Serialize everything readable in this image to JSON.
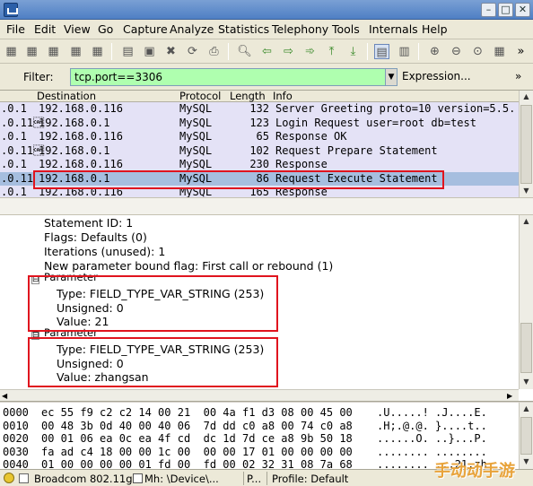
{
  "window": {
    "minimize": "–",
    "maximize": "□",
    "close": "✕"
  },
  "menu": [
    "File",
    "Edit",
    "View",
    "Go",
    "Capture",
    "Analyze",
    "Statistics",
    "Telephony",
    "Tools",
    "Internals",
    "Help"
  ],
  "filter": {
    "label": "Filter:",
    "value": "tcp.port==3306",
    "expression_label": "Expression...",
    "more": "»"
  },
  "toolbar_more": "»",
  "packet_list": {
    "columns": [
      "Destination",
      "Protocol",
      "Length",
      "Info"
    ],
    "rows": [
      {
        "src": ".0.1",
        "dst": "192.168.0.116",
        "proto": "MySQL",
        "len": "132",
        "info": "Server Greeting proto=10 version=5.5."
      },
      {
        "src": ".0.11\u0018",
        "dst": "192.168.0.1",
        "proto": "MySQL",
        "len": "123",
        "info": "Login Request user=root db=test"
      },
      {
        "src": ".0.1",
        "dst": "192.168.0.116",
        "proto": "MySQL",
        "len": "65",
        "info": "Response OK"
      },
      {
        "src": ".0.11\u0018",
        "dst": "192.168.0.1",
        "proto": "MySQL",
        "len": "102",
        "info": "Request Prepare Statement"
      },
      {
        "src": ".0.1",
        "dst": "192.168.0.116",
        "proto": "MySQL",
        "len": "230",
        "info": "Response"
      },
      {
        "src": ".0.11",
        "dst": "192.168.0.1",
        "proto": "MySQL",
        "len": "86",
        "info": "Request Execute Statement"
      },
      {
        "src": ".0.1",
        "dst": "192.168.0.116",
        "proto": "MySQL",
        "len": "165",
        "info": "Response"
      }
    ],
    "selected_index": 5
  },
  "detail": {
    "lines": [
      "Statement ID: 1",
      "Flags: Defaults (0)",
      "Iterations (unused): 1",
      "New parameter bound flag: First call or rebound (1)"
    ],
    "param1": {
      "header": "Parameter",
      "type": "Type: FIELD_TYPE_VAR_STRING (253)",
      "unsigned": "Unsigned: 0",
      "value": "Value: 21"
    },
    "param2": {
      "header": "Parameter",
      "type": "Type: FIELD_TYPE_VAR_STRING (253)",
      "unsigned": "Unsigned: 0",
      "value": "Value: zhangsan"
    },
    "expander_symbol": "⊟"
  },
  "hex": [
    {
      "offset": "0000",
      "bytes": "ec 55 f9 c2 c2 14 00 21  00 4a f1 d3 08 00 45 00",
      "ascii": ".U.....! .J....E."
    },
    {
      "offset": "0010",
      "bytes": "00 48 3b 0d 40 00 40 06  7d dd c0 a8 00 74 c0 a8",
      "ascii": ".H;.@.@. }....t.."
    },
    {
      "offset": "0020",
      "bytes": "00 01 06 ea 0c ea 4f cd  dc 1d 7d ce a8 9b 50 18",
      "ascii": "......O. ..}...P."
    },
    {
      "offset": "0030",
      "bytes": "fa ad c4 18 00 00 1c 00  00 00 17 01 00 00 00 00",
      "ascii": "........ ........"
    },
    {
      "offset": "0040",
      "bytes": "01 00 00 00 00 01 fd 00  fd 00 02 32 31 08 7a 68",
      "ascii": "........ ...21.zh"
    }
  ],
  "status": {
    "interface": "Broadcom 802.11g Q",
    "device": "Mh: \\Device\\...",
    "packets": "P...",
    "profile": "Profile: Default"
  },
  "watermark": "手动动手游",
  "colors": {
    "selected_row": "#a6bedf",
    "filter_valid": "#afffaf",
    "highlight_box": "#e0141e",
    "row_alt": "#e4e2f6"
  }
}
